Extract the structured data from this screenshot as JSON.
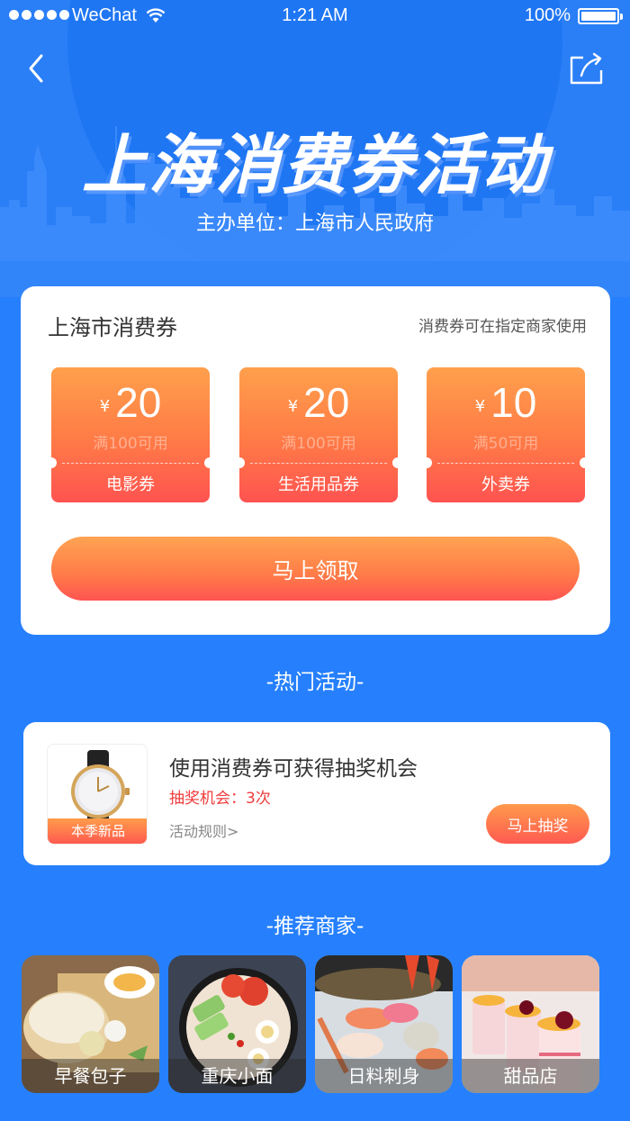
{
  "status_bar": {
    "carrier": "WeChat",
    "time": "1:21 AM",
    "battery": "100%"
  },
  "nav": {
    "back_icon": "chevron-left-icon",
    "share_icon": "share-icon"
  },
  "hero": {
    "title": "上海消费券活动",
    "organizer": "主办单位：上海市人民政府"
  },
  "coupon_section": {
    "title": "上海市消费券",
    "note": "消费券可在指定商家使用",
    "currency": "¥",
    "coupons": [
      {
        "amount": "20",
        "condition": "满100可用",
        "name": "电影券"
      },
      {
        "amount": "20",
        "condition": "满100可用",
        "name": "生活用品券"
      },
      {
        "amount": "10",
        "condition": "满50可用",
        "name": "外卖券"
      }
    ],
    "claim_label": "马上领取"
  },
  "hot_activities": {
    "section_title": "-热门活动-",
    "item": {
      "badge": "本季新品",
      "title": "使用消费券可获得抽奖机会",
      "chances": "抽奖机会：3次",
      "rules_link": "活动规则>",
      "draw_label": "马上抽奖"
    }
  },
  "merchants": {
    "section_title": "-推荐商家-",
    "items": [
      {
        "label": "早餐包子"
      },
      {
        "label": "重庆小面"
      },
      {
        "label": "日料刺身"
      },
      {
        "label": "甜品店"
      }
    ]
  },
  "colors": {
    "primary_blue": "#2680fd",
    "coupon_orange": "#ffa04c",
    "coupon_red": "#ff5351",
    "highlight_red": "#f03b3b"
  }
}
